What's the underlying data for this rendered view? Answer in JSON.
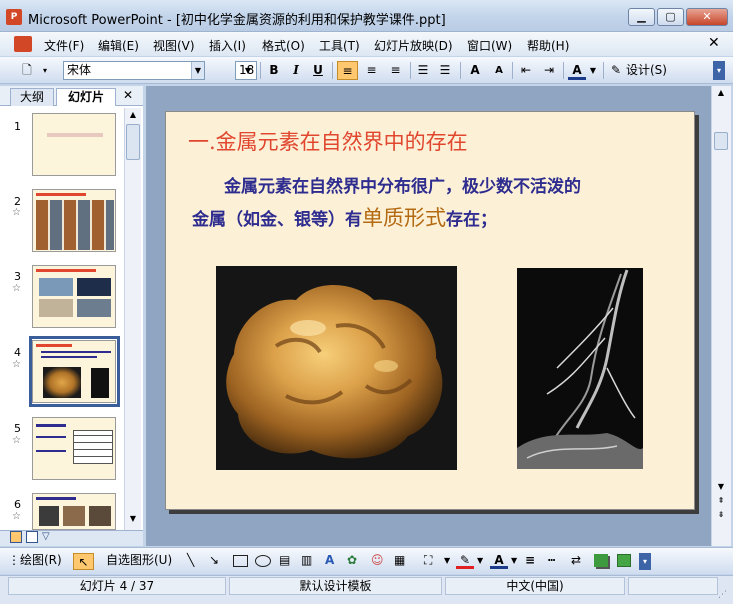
{
  "window": {
    "title": "Microsoft PowerPoint - [初中化学金属资源的利用和保护教学课件.ppt]",
    "app_icon": "P"
  },
  "menu": [
    "文件(F)",
    "编辑(E)",
    "视图(V)",
    "插入(I)",
    "格式(O)",
    "工具(T)",
    "幻灯片放映(D)",
    "窗口(W)",
    "帮助(H)"
  ],
  "toolbar": {
    "font": "宋体",
    "size": "18",
    "bold": "B",
    "italic": "I",
    "underline": "U",
    "increase_font": "A",
    "decrease_font": "A",
    "font_color": "A",
    "design": "设计(S)"
  },
  "pane": {
    "tab_outline": "大纲",
    "tab_slides": "幻灯片",
    "close": "✕"
  },
  "thumbnails": [
    {
      "num": "1"
    },
    {
      "num": "2"
    },
    {
      "num": "3"
    },
    {
      "num": "4"
    },
    {
      "num": "5"
    },
    {
      "num": "6"
    }
  ],
  "slide": {
    "title": "一.金属元素在自然界中的存在",
    "body_line1": "金属元素在自然界中分布很广，极少数不活泼的",
    "body_line2_a": "金属（如金、银等）有",
    "body_emph": "单质形式",
    "body_line2_b": "存在；"
  },
  "drawbar": {
    "draw": "绘图(R)",
    "autoshapes": "自选图形(U)"
  },
  "status": {
    "slide": "幻灯片 4 / 37",
    "template": "默认设计模板",
    "language": "中文(中国)"
  },
  "colors": {
    "title_red": "#e1462f",
    "body_blue": "#2e2d8f",
    "emph": "#b46a12",
    "slide_bg": "#fcf1d7"
  }
}
